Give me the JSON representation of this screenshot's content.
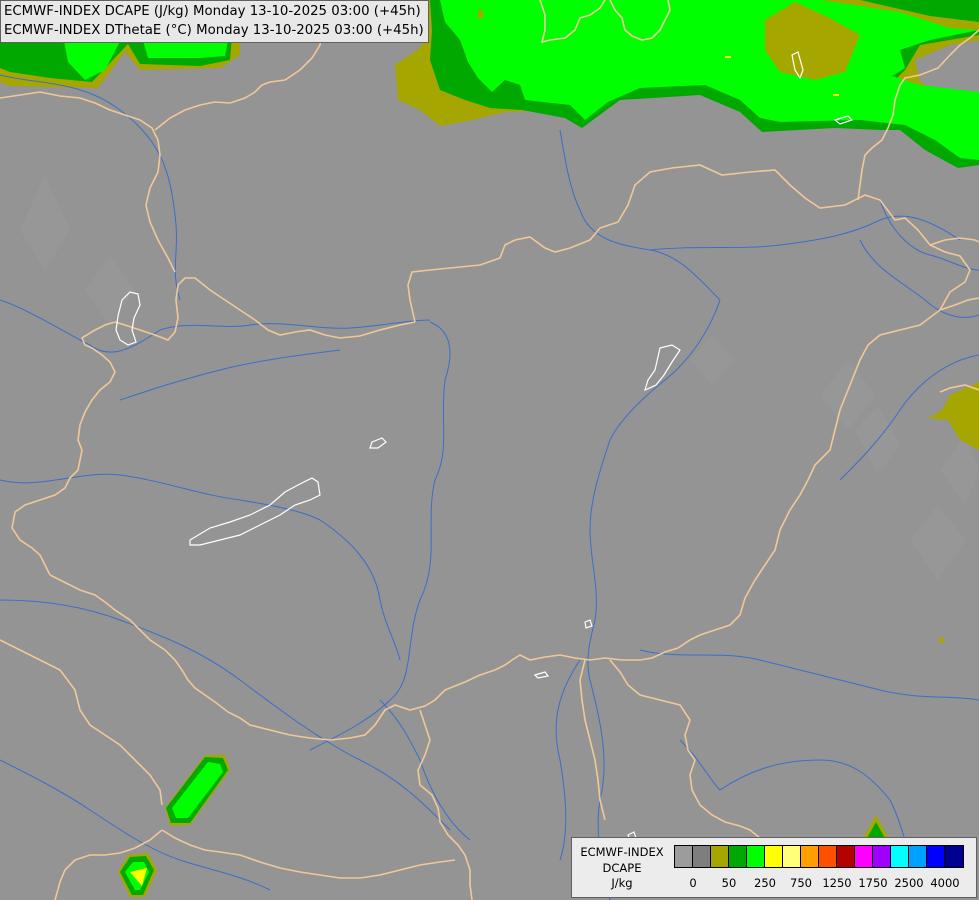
{
  "header": {
    "line1": "ECMWF-INDEX DCAPE (J/kg) Monday 13-10-2025 03:00 (+45h)",
    "line2": "ECMWF-INDEX DThetaE (°C) Monday 13-10-2025 03:00 (+45h)"
  },
  "legend": {
    "name_line1": "ECMWF-INDEX",
    "name_line2": "DCAPE",
    "unit": "J/kg",
    "swatch_colors": [
      "#9c9c9c",
      "#7e7e7e",
      "#a6a600",
      "#00a800",
      "#00ff00",
      "#ffff00",
      "#ffff78",
      "#ffa000",
      "#ff5000",
      "#b40000",
      "#ff00ff",
      "#a000ff",
      "#00ffff",
      "#00a0ff",
      "#0000ff",
      "#000090"
    ],
    "tick_labels": [
      "0",
      "50",
      "250",
      "750",
      "1250",
      "1750",
      "2500",
      "4000"
    ]
  },
  "colors": {
    "background": "#949494",
    "borders": "#f0c898",
    "rivers": "#3c6ec8",
    "lakes": "#ffffff",
    "dark_green": "#00a800",
    "bright_green": "#00ff00",
    "olive": "#a6a600",
    "yellow": "#ffff00"
  }
}
